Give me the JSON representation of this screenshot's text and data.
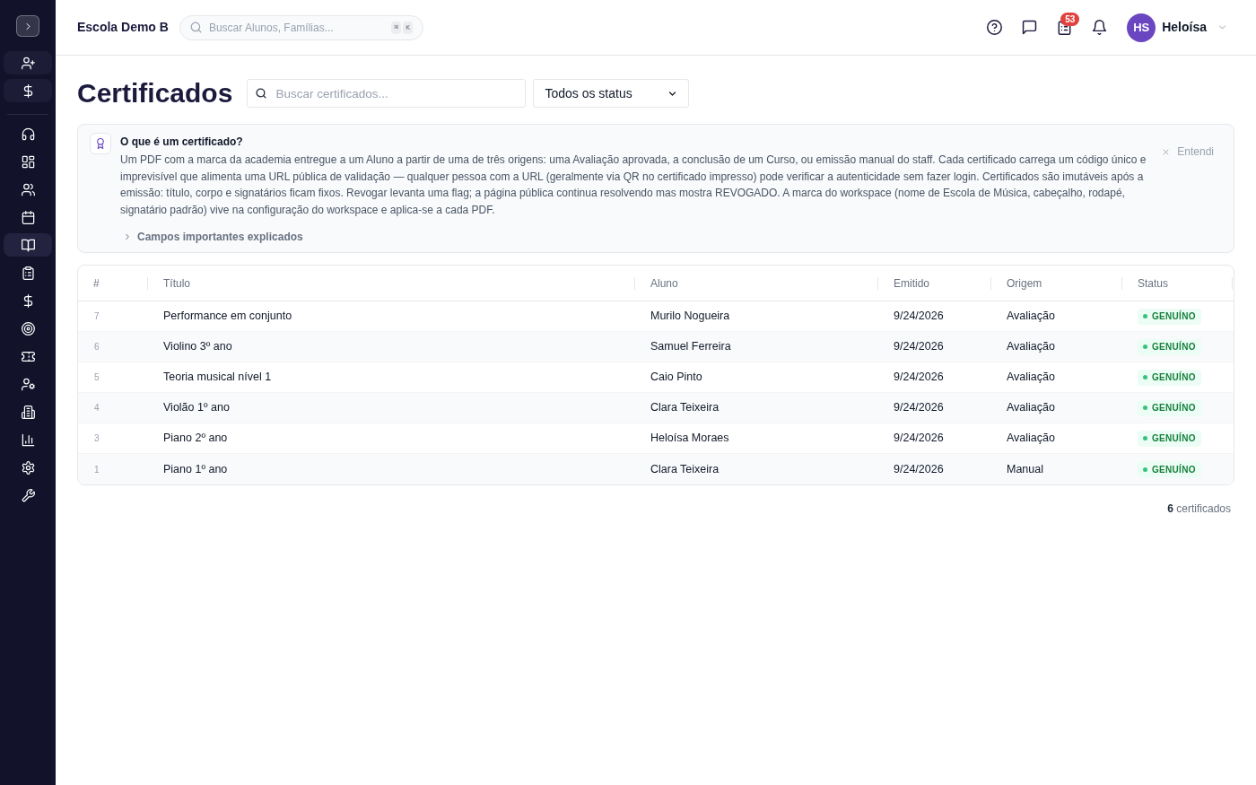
{
  "sidebar": {
    "nav_items": [
      {
        "selected": false
      },
      {
        "selected": false
      },
      {
        "selected": false
      },
      {
        "selected": false
      },
      {
        "selected": true
      },
      {
        "selected": false
      },
      {
        "selected": false
      },
      {
        "selected": false
      },
      {
        "selected": false
      },
      {
        "selected": false
      },
      {
        "selected": false
      },
      {
        "selected": false
      },
      {
        "selected": false
      },
      {
        "selected": false
      }
    ]
  },
  "topbar": {
    "workspace": "Escola Demo B",
    "search": {
      "placeholder": "Buscar Alunos, Famílias...",
      "shortcut": [
        "⌘",
        "K"
      ]
    },
    "tasks_badge": "53",
    "user": {
      "initials": "HS",
      "name": "Heloísa"
    }
  },
  "page": {
    "title": "Certificados",
    "search": {
      "placeholder": "Buscar certificados..."
    },
    "status_filter": {
      "value": "Todos os status"
    }
  },
  "info_panel": {
    "title": "O que é um certificado?",
    "body": "Um PDF com a marca da academia entregue a um Aluno a partir de uma de três origens: uma Avaliação aprovada, a conclusão de um Curso, ou emissão manual do staff. Cada certificado carrega um código único e imprevisível que alimenta uma URL pública de validação — qualquer pessoa com a URL (geralmente via QR no certificado impresso) pode verificar a autenticidade sem fazer login. Certificados são imutáveis após a emissão: título, corpo e signatários ficam fixos. Revogar levanta uma flag; a página pública continua resolvendo mas mostra REVOGADO. A marca do workspace (nome de Escola de Música, cabeçalho, rodapé, signatário padrão) vive na configuração do workspace e aplica-se a cada PDF.",
    "dismiss": "Entendi",
    "details": {
      "label": "Campos importantes explicados",
      "expanded": false
    }
  },
  "table": {
    "columns": [
      "#",
      "Título",
      "Aluno",
      "Emitido",
      "Origem",
      "Status"
    ],
    "rows": [
      {
        "number": "7",
        "title": "Performance em conjunto",
        "student": "Murilo Nogueira",
        "issued": "9/24/2026",
        "origin": "Avaliação",
        "status": {
          "label": "GENUÍNO",
          "kind": "genuine"
        }
      },
      {
        "number": "6",
        "title": "Violino 3º ano",
        "student": "Samuel Ferreira",
        "issued": "9/24/2026",
        "origin": "Avaliação",
        "status": {
          "label": "GENUÍNO",
          "kind": "genuine"
        }
      },
      {
        "number": "5",
        "title": "Teoria musical nível 1",
        "student": "Caio Pinto",
        "issued": "9/24/2026",
        "origin": "Avaliação",
        "status": {
          "label": "GENUÍNO",
          "kind": "genuine"
        }
      },
      {
        "number": "4",
        "title": "Violão 1º ano",
        "student": "Clara Teixeira",
        "issued": "9/24/2026",
        "origin": "Avaliação",
        "status": {
          "label": "GENUÍNO",
          "kind": "genuine"
        }
      },
      {
        "number": "3",
        "title": "Piano 2º ano",
        "student": "Heloísa Moraes",
        "issued": "9/24/2026",
        "origin": "Avaliação",
        "status": {
          "label": "GENUÍNO",
          "kind": "genuine"
        }
      },
      {
        "number": "1",
        "title": "Piano 1º ano",
        "student": "Clara Teixeira",
        "issued": "9/24/2026",
        "origin": "Manual",
        "status": {
          "label": "GENUÍNO",
          "kind": "genuine"
        }
      }
    ]
  },
  "footer": {
    "count": "**6** certificados"
  }
}
